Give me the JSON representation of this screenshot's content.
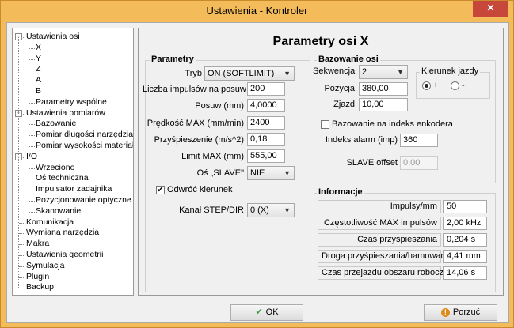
{
  "window": {
    "title": "Ustawienia - Kontroler",
    "close_glyph": "✕"
  },
  "tree": {
    "items": [
      {
        "label": "Ustawienia osi",
        "depth": 0,
        "expander": "-"
      },
      {
        "label": "X",
        "depth": 1
      },
      {
        "label": "Y",
        "depth": 1
      },
      {
        "label": "Z",
        "depth": 1
      },
      {
        "label": "A",
        "depth": 1
      },
      {
        "label": "B",
        "depth": 1
      },
      {
        "label": "Parametry wspólne",
        "depth": 1
      },
      {
        "label": "Ustawienia pomiarów",
        "depth": 0,
        "expander": "-"
      },
      {
        "label": "Bazowanie",
        "depth": 1
      },
      {
        "label": "Pomiar długości narzędzia",
        "depth": 1
      },
      {
        "label": "Pomiar wysokości materiału",
        "depth": 1
      },
      {
        "label": "I/O",
        "depth": 0,
        "expander": "-"
      },
      {
        "label": "Wrzeciono",
        "depth": 1
      },
      {
        "label": "Oś techniczna",
        "depth": 1
      },
      {
        "label": "Impulsator zadajnika",
        "depth": 1
      },
      {
        "label": "Pozycjonowanie optyczne",
        "depth": 1
      },
      {
        "label": "Skanowanie",
        "depth": 1
      },
      {
        "label": "Komunikacja",
        "depth": 0
      },
      {
        "label": "Wymiana narzędzia",
        "depth": 0
      },
      {
        "label": "Makra",
        "depth": 0
      },
      {
        "label": "Ustawienia geometrii",
        "depth": 0
      },
      {
        "label": "Symulacja",
        "depth": 0
      },
      {
        "label": "Plugin",
        "depth": 0
      },
      {
        "label": "Backup",
        "depth": 0
      }
    ]
  },
  "main": {
    "title": "Parametry osi X",
    "parametry": {
      "group_label": "Parametry",
      "tryb_label": "Tryb",
      "tryb_value": "ON (SOFTLIMIT)",
      "impulsy_label": "Liczba impulsów na posuw",
      "impulsy_value": "200",
      "posuw_label": "Posuw (mm)",
      "posuw_value": "4,0000",
      "predkosc_label": "Prędkość MAX (mm/min)",
      "predkosc_value": "2400",
      "przyspieszenie_label": "Przyśpieszenie (m/s^2)",
      "przyspieszenie_value": "0,18",
      "limit_label": "Limit MAX (mm)",
      "limit_value": "555,00",
      "slave_label": "Oś „SLAVE\"",
      "slave_value": "NIE",
      "odwroc_label": "Odwróć kierunek",
      "odwroc_checked": "✔",
      "kanal_label": "Kanał STEP/DIR",
      "kanal_value": "0 (X)"
    },
    "bazowanie": {
      "group_label": "Bazowanie osi",
      "sekwencja_label": "Sekwencja",
      "sekwencja_value": "2",
      "pozycja_label": "Pozycja",
      "pozycja_value": "380,00",
      "zjazd_label": "Zjazd",
      "zjazd_value": "10,00",
      "kierunek_label": "Kierunek jazdy",
      "kierunek_plus": "+",
      "kierunek_minus": "-",
      "enkoder_label": "Bazowanie na indeks enkodera",
      "indeks_label": "Indeks alarm (imp)",
      "indeks_value": "360",
      "slave_offset_label": "SLAVE offset",
      "slave_offset_value": "0,00"
    },
    "informacje": {
      "group_label": "Informacje",
      "rows": [
        {
          "label": "Impulsy/mm",
          "value": "50"
        },
        {
          "label": "Częstotliwość MAX impulsów",
          "value": "2,00 kHz"
        },
        {
          "label": "Czas przyśpieszania",
          "value": "0,204 s"
        },
        {
          "label": "Droga przyśpieszania/hamowania",
          "value": "4,41 mm"
        },
        {
          "label": "Czas przejazdu obszaru roboczego",
          "value": "14,06 s"
        }
      ]
    }
  },
  "buttons": {
    "ok_label": "OK",
    "ok_icon": "✔",
    "cancel_label": "Porzuć",
    "cancel_icon": "!"
  },
  "colors": {
    "frame": "#f3bb5a",
    "close": "#c7483a",
    "ok_icon": "#3a9a3a",
    "cancel_icon": "#e08a1a"
  }
}
